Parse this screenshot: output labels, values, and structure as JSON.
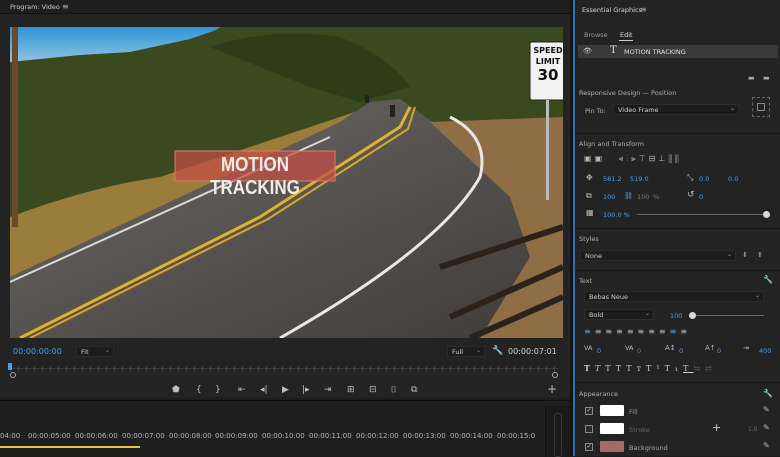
{
  "program": {
    "title": "Program: Video",
    "menu_icon": "hamburger-icon",
    "video_title": "MOTION TRACKING",
    "sign": {
      "line1": "SPEED",
      "line2": "LIMIT",
      "line3": "30"
    },
    "timecode_current": "00:00:00:00",
    "fit_label": "Fit",
    "quality_label": "Full",
    "timecode_total": "00:00:07:01"
  },
  "timeline": {
    "ruler": [
      "04:00",
      "00:00:05:00",
      "00:00:06:00",
      "00:00:07:00",
      "00:00:08:00",
      "00:00:09:00",
      "00:00:10:00",
      "00:00:11:00",
      "00:00:12:00",
      "00:00:13:00",
      "00:00:14:00",
      "00:00:15:0"
    ]
  },
  "eg": {
    "title": "Essential Graphics",
    "tabs": [
      "Browse",
      "Edit"
    ],
    "layer_name": "MOTION TRACKING",
    "responsive": {
      "title": "Responsive Design — Position",
      "pin_label": "Pin To:",
      "pin_value": "Video Frame"
    },
    "align": {
      "title": "Align and Transform",
      "pos_x": "581.2",
      "pos_y": "519.0",
      "anchor_x": "0.0",
      "anchor_y": "0.0",
      "scale": "100",
      "scale2": "100",
      "scale_pct": "%",
      "rotation": "0",
      "opacity": "100.0 %"
    },
    "styles": {
      "title": "Styles",
      "value": "None"
    },
    "text": {
      "title": "Text",
      "font": "Bebas Neue",
      "weight": "Bold",
      "size": "100",
      "tracking": "0",
      "leading": "0",
      "kerning": "0",
      "baseline": "0",
      "tsume": "0",
      "tab_width": "400"
    },
    "appearance": {
      "title": "Appearance",
      "fill_label": "Fill",
      "stroke_label": "Stroke",
      "stroke_width": "1.0",
      "background_label": "Background",
      "fill_color": "#ffffff",
      "stroke_color": "#ffffff",
      "background_color": "#a66a66"
    }
  },
  "colors": {
    "accent": "#4b9cf2",
    "panel": "#232323",
    "title_box": "#c24f45"
  }
}
